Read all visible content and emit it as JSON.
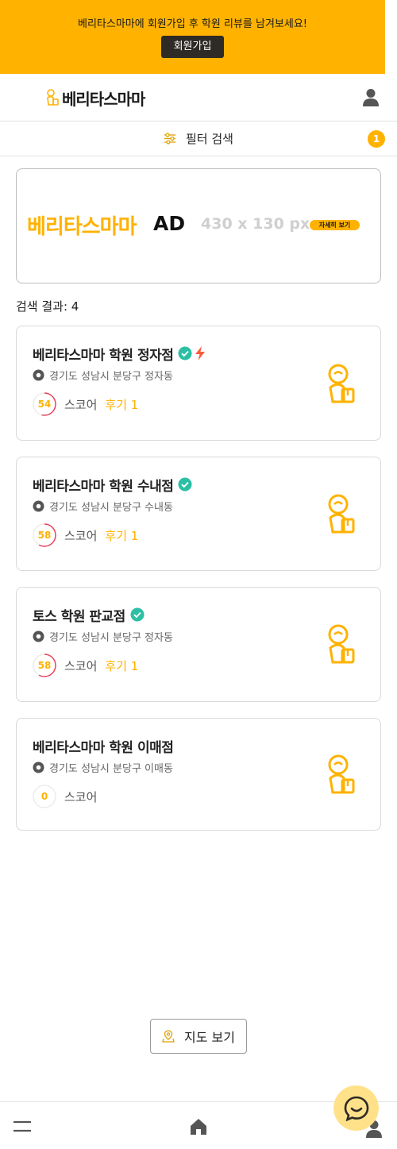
{
  "promo": {
    "text": "베리타스마마에 회원가입 후 학원 리뷰를 남겨보세요!",
    "signup_label": "회원가입"
  },
  "header": {
    "logo_text": "베리타스마마",
    "logo_icon": "mother-child-icon",
    "user_icon": "user-icon"
  },
  "filter": {
    "label": "필터 검색",
    "icon": "sliders-icon",
    "badge_count": "1"
  },
  "ad_banner": {
    "brand": "베리타스마마",
    "ad": "AD",
    "size": "430 x 130 px",
    "more_label": "자세히 보기"
  },
  "results": {
    "label": "검색 결과: 4"
  },
  "cards": [
    {
      "title": "베리타스마마 학원 정자점",
      "verified": true,
      "featured": true,
      "address": "경기도 성남시 분당구 정자동",
      "score": "54",
      "score_value": 54,
      "score_label": "스코어",
      "review_label": "후기 1"
    },
    {
      "title": "베리타스마마 학원 수내점",
      "verified": true,
      "featured": false,
      "address": "경기도 성남시 분당구 수내동",
      "score": "58",
      "score_value": 58,
      "score_label": "스코어",
      "review_label": "후기 1"
    },
    {
      "title": "토스 학원 판교점",
      "verified": true,
      "featured": false,
      "address": "경기도 성남시 분당구 정자동",
      "score": "58",
      "score_value": 58,
      "score_label": "스코어",
      "review_label": "후기 1"
    },
    {
      "title": "베리타스마마 학원 이매점",
      "verified": false,
      "featured": false,
      "address": "경기도 성남시 분당구 이매동",
      "score": "0",
      "score_value": 0,
      "score_label": "스코어",
      "review_label": ""
    }
  ],
  "map_button": {
    "label": "지도 보기",
    "icon": "map-pin-icon"
  },
  "bottom_nav": {
    "menu_icon": "menu-icon",
    "home_icon": "home-icon",
    "user_icon": "user-icon"
  },
  "chat": {
    "icon": "chat-smile-icon"
  },
  "colors": {
    "accent": "#ffb200",
    "verified": "#2bbfa4",
    "featured": "#ff5a3c",
    "score_ring": "#e8455b",
    "dark_button": "#2e2a26"
  }
}
